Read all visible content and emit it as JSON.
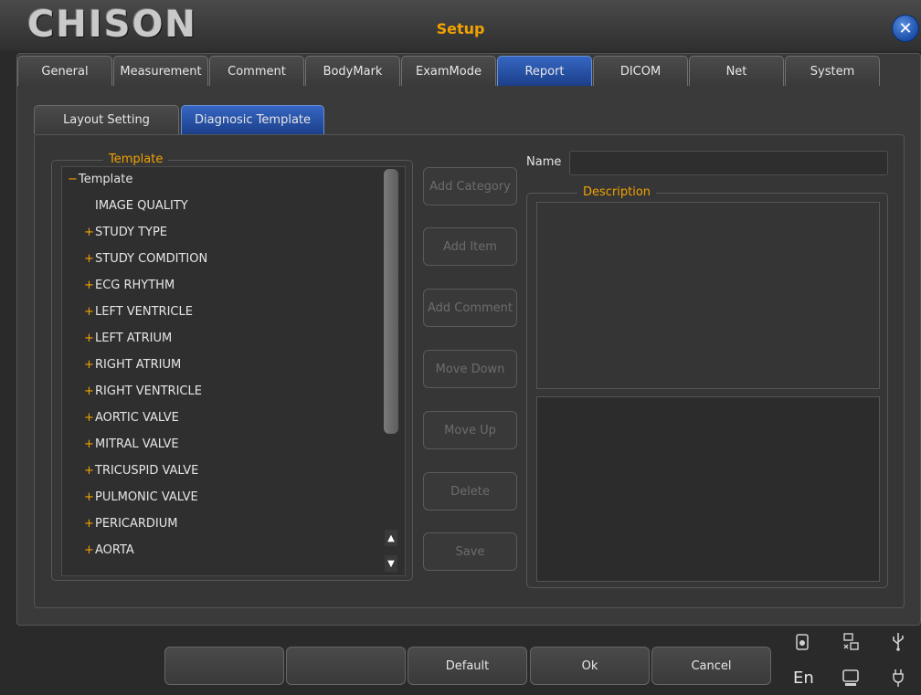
{
  "brand": {
    "logo_text": "CHISON"
  },
  "window": {
    "title": "Setup",
    "close_glyph": "✕"
  },
  "tabs": [
    {
      "label": "General"
    },
    {
      "label": "Measurement"
    },
    {
      "label": "Comment"
    },
    {
      "label": "BodyMark"
    },
    {
      "label": "ExamMode"
    },
    {
      "label": "Report",
      "active": true
    },
    {
      "label": "DICOM"
    },
    {
      "label": "Net"
    },
    {
      "label": "System"
    }
  ],
  "subtabs": [
    {
      "label": "Layout Setting"
    },
    {
      "label": "Diagnosic Template",
      "active": true
    }
  ],
  "template_panel": {
    "title": "Template",
    "root": {
      "sign": "−",
      "label": "Template"
    },
    "items": [
      {
        "sign": "",
        "label": "IMAGE QUALITY"
      },
      {
        "sign": "+",
        "label": "STUDY TYPE"
      },
      {
        "sign": "+",
        "label": "STUDY COMDITION"
      },
      {
        "sign": "+",
        "label": "ECG RHYTHM"
      },
      {
        "sign": "+",
        "label": "LEFT VENTRICLE"
      },
      {
        "sign": "+",
        "label": "LEFT ATRIUM"
      },
      {
        "sign": "+",
        "label": "RIGHT ATRIUM"
      },
      {
        "sign": "+",
        "label": "RIGHT VENTRICLE"
      },
      {
        "sign": "+",
        "label": "AORTIC VALVE"
      },
      {
        "sign": "+",
        "label": "MITRAL VALVE"
      },
      {
        "sign": "+",
        "label": "TRICUSPID VALVE"
      },
      {
        "sign": "+",
        "label": "PULMONIC VALVE"
      },
      {
        "sign": "+",
        "label": "PERICARDIUM"
      },
      {
        "sign": "+",
        "label": "AORTA"
      }
    ],
    "scroll_up_glyph": "▲",
    "scroll_down_glyph": "▼"
  },
  "actions": {
    "add_category": "Add Category",
    "add_item": "Add Item",
    "add_comment": "Add Comment",
    "move_down": "Move Down",
    "move_up": "Move Up",
    "delete": "Delete",
    "save": "Save"
  },
  "name_field": {
    "label": "Name",
    "value": ""
  },
  "description": {
    "title": "Description"
  },
  "bottom_buttons": {
    "blank1": "",
    "blank2": "",
    "default": "Default",
    "ok": "Ok",
    "cancel": "Cancel"
  },
  "status": {
    "language": "En",
    "icons": [
      "disk-icon",
      "network-icon",
      "usb-icon",
      "monitor-icon",
      "power-plug-icon"
    ]
  },
  "colors": {
    "accent_orange": "#f2a200",
    "active_tab_blue": "#1c3f8a",
    "background": "#2a2a2a"
  }
}
